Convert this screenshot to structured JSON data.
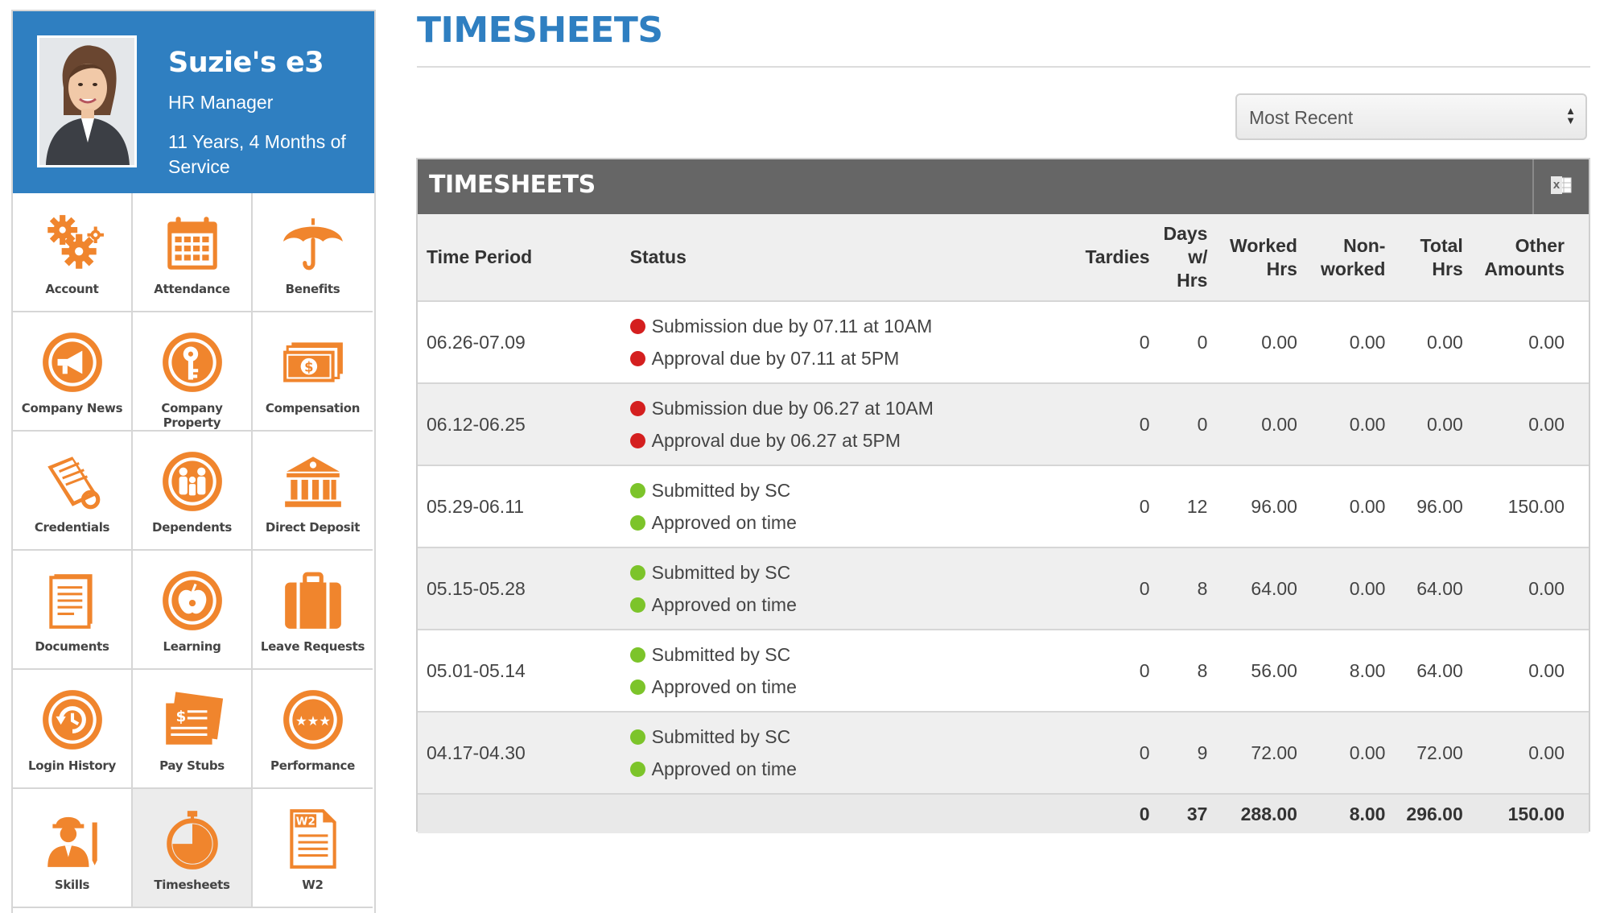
{
  "profile": {
    "name": "Suzie's e3",
    "role": "HR Manager",
    "service": "11 Years, 4 Months of Service"
  },
  "tiles": [
    {
      "label": "Account",
      "icon": "gears-icon"
    },
    {
      "label": "Attendance",
      "icon": "calendar-icon"
    },
    {
      "label": "Benefits",
      "icon": "umbrella-icon"
    },
    {
      "label": "Company News",
      "icon": "megaphone-icon"
    },
    {
      "label": "Company Property",
      "icon": "key-icon"
    },
    {
      "label": "Compensation",
      "icon": "money-icon"
    },
    {
      "label": "Credentials",
      "icon": "diploma-icon"
    },
    {
      "label": "Dependents",
      "icon": "family-icon"
    },
    {
      "label": "Direct Deposit",
      "icon": "bank-icon"
    },
    {
      "label": "Documents",
      "icon": "document-icon"
    },
    {
      "label": "Learning",
      "icon": "apple-icon"
    },
    {
      "label": "Leave Requests",
      "icon": "suitcase-icon"
    },
    {
      "label": "Login History",
      "icon": "history-icon"
    },
    {
      "label": "Pay Stubs",
      "icon": "paystub-icon"
    },
    {
      "label": "Performance",
      "icon": "stars-icon"
    },
    {
      "label": "Skills",
      "icon": "worker-icon"
    },
    {
      "label": "Timesheets",
      "icon": "stopwatch-icon"
    },
    {
      "label": "W2",
      "icon": "w2-icon"
    }
  ],
  "page": {
    "title": "TIMESHEETS"
  },
  "sort": {
    "selected": "Most Recent"
  },
  "panel": {
    "title": "TIMESHEETS",
    "export_icon": "excel-export-icon"
  },
  "table": {
    "headers": {
      "period": "Time Period",
      "status": "Status",
      "tardies": "Tardies",
      "days_1": "Days",
      "days_2": "w/",
      "days_3": "Hrs",
      "worked_1": "Worked",
      "worked_2": "Hrs",
      "non_1": "Non-",
      "non_2": "worked",
      "total_1": "Total",
      "total_2": "Hrs",
      "other_1": "Other",
      "other_2": "Amounts"
    },
    "rows": [
      {
        "period": "06.26-07.09",
        "s1": "Submission due by 07.11 at 10AM",
        "s1_color": "#d41f1f",
        "s2": "Approval due by 07.11 at 5PM",
        "s2_color": "#d41f1f",
        "tardies": "0",
        "days": "0",
        "worked": "0.00",
        "nonworked": "0.00",
        "total": "0.00",
        "other": "0.00"
      },
      {
        "period": "06.12-06.25",
        "s1": "Submission due by 06.27 at 10AM",
        "s1_color": "#d41f1f",
        "s2": "Approval due by 06.27 at 5PM",
        "s2_color": "#d41f1f",
        "tardies": "0",
        "days": "0",
        "worked": "0.00",
        "nonworked": "0.00",
        "total": "0.00",
        "other": "0.00"
      },
      {
        "period": "05.29-06.11",
        "s1": "Submitted by SC",
        "s1_color": "#7cc42a",
        "s2": "Approved on time",
        "s2_color": "#7cc42a",
        "tardies": "0",
        "days": "12",
        "worked": "96.00",
        "nonworked": "0.00",
        "total": "96.00",
        "other": "150.00"
      },
      {
        "period": "05.15-05.28",
        "s1": "Submitted by SC",
        "s1_color": "#7cc42a",
        "s2": "Approved on time",
        "s2_color": "#7cc42a",
        "tardies": "0",
        "days": "8",
        "worked": "64.00",
        "nonworked": "0.00",
        "total": "64.00",
        "other": "0.00"
      },
      {
        "period": "05.01-05.14",
        "s1": "Submitted by SC",
        "s1_color": "#7cc42a",
        "s2": "Approved on time",
        "s2_color": "#7cc42a",
        "tardies": "0",
        "days": "8",
        "worked": "56.00",
        "nonworked": "8.00",
        "total": "64.00",
        "other": "0.00"
      },
      {
        "period": "04.17-04.30",
        "s1": "Submitted by SC",
        "s1_color": "#7cc42a",
        "s2": "Approved on time",
        "s2_color": "#7cc42a",
        "tardies": "0",
        "days": "9",
        "worked": "72.00",
        "nonworked": "0.00",
        "total": "72.00",
        "other": "0.00"
      }
    ],
    "totals": {
      "tardies": "0",
      "days": "37",
      "worked": "288.00",
      "nonworked": "8.00",
      "total": "296.00",
      "other": "150.00"
    }
  },
  "colors": {
    "accent": "#2f7fc1",
    "icon_orange": "#f0852d",
    "header_gray": "#666666",
    "status_red": "#d41f1f",
    "status_green": "#7cc42a"
  }
}
